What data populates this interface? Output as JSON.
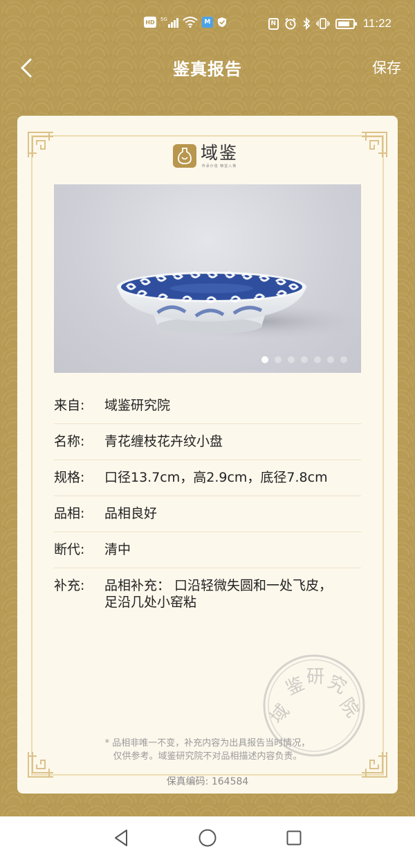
{
  "status_bar": {
    "left_icons": [
      "hd-icon",
      "5g-signal-icon",
      "wifi-icon",
      "app-notification-icon",
      "shield-icon"
    ],
    "hd": "HD",
    "net": "5G",
    "right_icons": [
      "nfc-icon",
      "alarm-icon",
      "bluetooth-icon",
      "vibrate-icon",
      "battery-icon"
    ],
    "time": "11:22",
    "battery_level": 0.8
  },
  "header": {
    "title": "鉴真报告",
    "save_label": "保存"
  },
  "logo": {
    "name": "域鉴",
    "subtitle": "传承价值  精鉴入微"
  },
  "photo": {
    "subject": "blue-and-white porcelain dish",
    "slide_count": 7,
    "active_slide": 1
  },
  "info_rows": [
    {
      "label": "来自:",
      "value": "域鉴研究院"
    },
    {
      "label": "名称:",
      "value": "青花缠枝花卉纹小盘"
    },
    {
      "label": "规格:",
      "value": "口径13.7cm，高2.9cm，底径7.8cm"
    },
    {
      "label": "品相:",
      "value": "品相良好"
    },
    {
      "label": "断代:",
      "value": "清中"
    },
    {
      "label": "补充:",
      "value": "品相补充：  口沿轻微失圆和一处飞皮，足沿几处小窑粘"
    }
  ],
  "stamp": {
    "text": "域鉴研究院"
  },
  "disclaimer": {
    "line1": "* 品相非唯一不变，补充内容为出具报告当时情况，",
    "line2": "仅供参考。域鉴研究院不对品相描述内容负责。"
  },
  "certificate": {
    "label": "保真编码:",
    "number": "164584"
  },
  "colors": {
    "gold": "#b89b55",
    "card": "#fdf8ec",
    "frame": "#ecdcb3",
    "porcelain_blue": "#2f4f9e"
  }
}
